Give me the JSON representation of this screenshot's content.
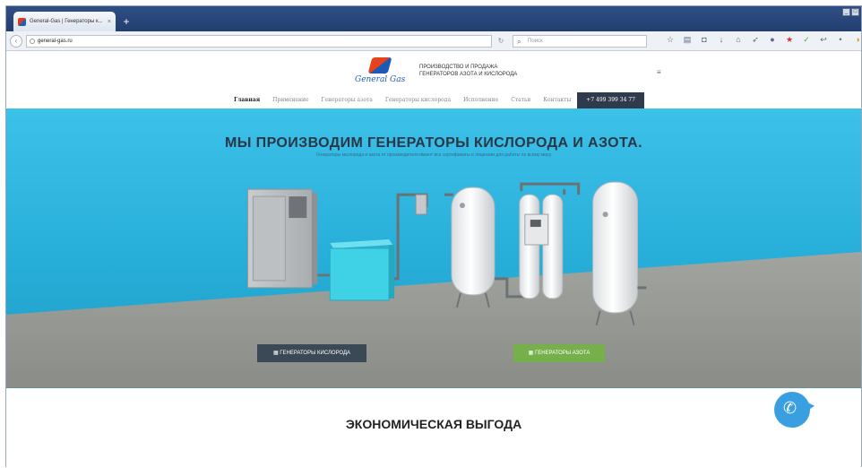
{
  "browser": {
    "tab_title": "General-Gas | Генераторы к...",
    "tab_close": "×",
    "new_tab": "+",
    "url": "general-gas.ru",
    "search_placeholder": "Поиск",
    "window_controls": [
      "_",
      "□"
    ],
    "toolbar_icons": [
      "star-icon",
      "bookmarks-icon",
      "pocket-icon",
      "download-icon",
      "home-icon",
      "send-icon",
      "chat-icon",
      "addon-red-icon",
      "addon-green-icon",
      "addon-arrow-icon",
      "addon-dot-icon",
      "addon-globe-icon",
      "menu-icon"
    ]
  },
  "site": {
    "logo_text": "General Gas",
    "tagline_line1": "ПРОИЗВОДСТВО И ПРОДАЖА",
    "tagline_line2": "ГЕНЕРАТОРОВ АЗОТА И КИСЛОРОДА",
    "header_menu_icon": "≡",
    "nav": [
      {
        "label": "Главная",
        "active": true
      },
      {
        "label": "Применение"
      },
      {
        "label": "Генераторы азота"
      },
      {
        "label": "Генераторы кислорода"
      },
      {
        "label": "Исполнение"
      },
      {
        "label": "Статьи"
      },
      {
        "label": "Контакты"
      }
    ],
    "phone": "+7 499 399 34 77"
  },
  "hero": {
    "title": "МЫ ПРОИЗВОДИМ ГЕНЕРАТОРЫ КИСЛОРОДА И АЗОТА.",
    "subtitle": "Генераторы кислорода и азота от производителя имеют все сертификаты и лицензии для работы по всему миру",
    "button_oxygen": "ГЕНЕРАТОРЫ КИСЛОРОДА",
    "button_nitrogen": "ГЕНЕРАТОРЫ АЗОТА"
  },
  "section": {
    "title": "ЭКОНОМИЧЕСКАЯ ВЫГОДА"
  },
  "call_widget": {
    "icon": "phone-icon"
  }
}
